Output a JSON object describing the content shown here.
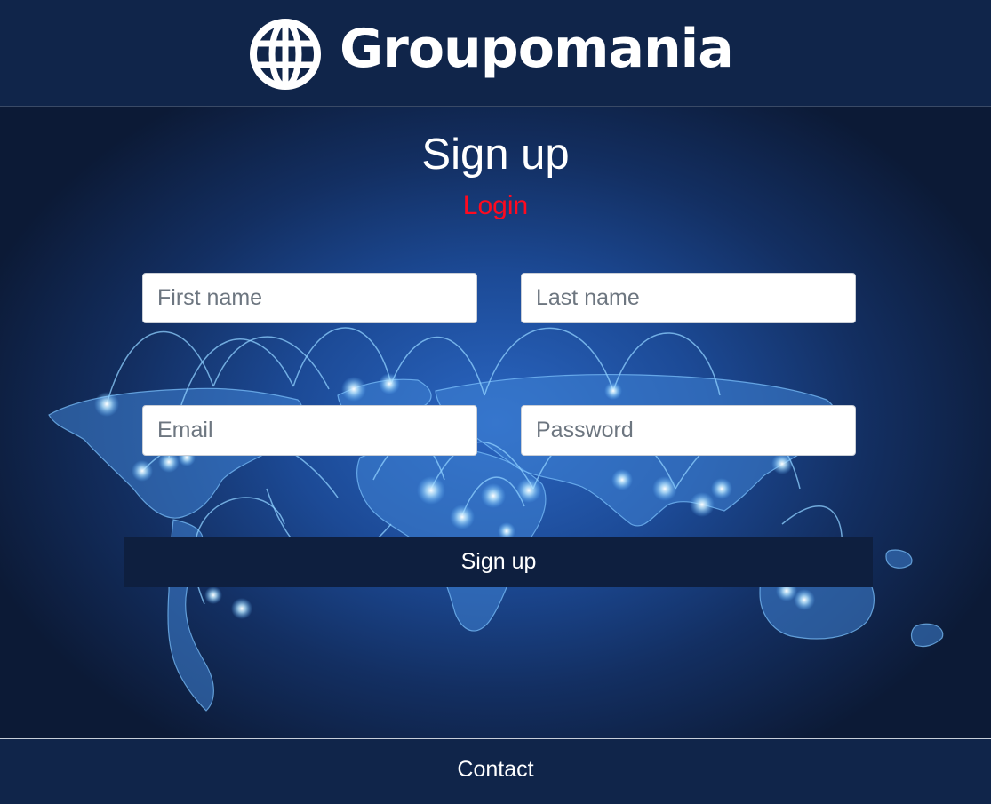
{
  "header": {
    "brand_name": "Groupomania",
    "logo_icon": "globe-icon"
  },
  "form": {
    "title": "Sign up",
    "login_link": "Login",
    "first_name_placeholder": "First name",
    "last_name_placeholder": "Last name",
    "email_placeholder": "Email",
    "password_placeholder": "Password",
    "submit_label": "Sign up"
  },
  "footer": {
    "contact_label": "Contact"
  },
  "colors": {
    "header_bg": "#10254a",
    "login_link": "#ff0a1f",
    "submit_bg": "#0e1f3f",
    "map_glow": "#2a66c2"
  }
}
